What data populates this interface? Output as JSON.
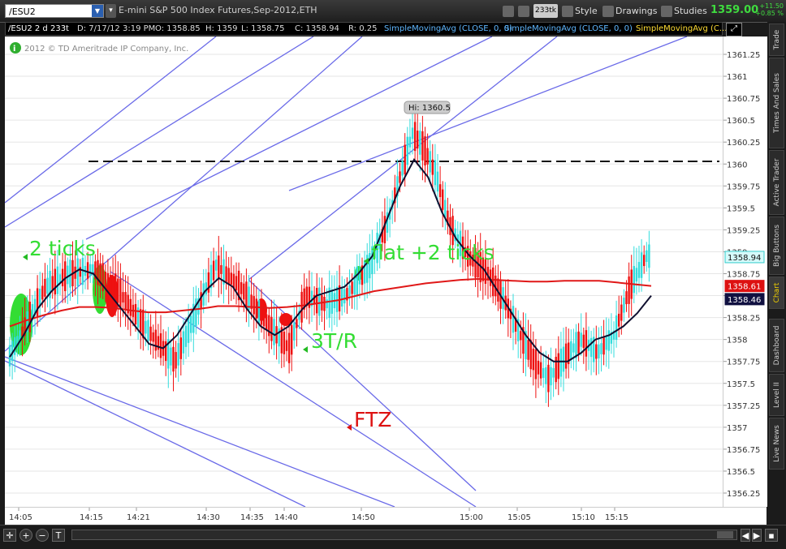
{
  "toolbar": {
    "symbol": "/ESU2",
    "description": "E-mini S&P 500 Index Futures,Sep-2012,ETH",
    "ticks_badge": "233tk",
    "style_label": "Style",
    "drawings_label": "Drawings",
    "studies_label": "Studies",
    "last_price": "1359.00",
    "change_abs": "+11.50",
    "change_pct": "+0.85 %"
  },
  "infobar": {
    "symbol_period": "/ESU2 2 d 233t",
    "date": "D: 7/17/12 3:19 PM",
    "open": "O: 1358.85",
    "high": "H: 1359",
    "low": "L: 1358.75",
    "close": "C: 1358.94",
    "range": "R: 0.25",
    "study1": "SimpleMovingAvg (CLOSE, 0, 0)",
    "study2": "SimpleMovingAvg (CLOSE, 0, 0)",
    "study3": "SimpleMovingAvg (C..."
  },
  "copyright": "2012 © TD Ameritrade IP Company, Inc.",
  "sidebar": {
    "tabs": [
      "Trade",
      "Times And Sales",
      "Active Trader",
      "Big Buttons",
      "Chart",
      "Dashboard",
      "Level II",
      "Live News"
    ]
  },
  "colors": {
    "up_bar": "#33dddd",
    "down_bar": "#ee1111",
    "trendline": "#6a6ae8",
    "sma_fast": "#101030",
    "sma_slow": "#e01818",
    "annot_green": "#33dd33",
    "annot_red": "#dd1111"
  },
  "chart_data": {
    "type": "candlestick",
    "y_ticks": [
      "1361.25",
      "1361",
      "1360.75",
      "1360.5",
      "1360.25",
      "1360",
      "1359.75",
      "1359.5",
      "1359.25",
      "1359",
      "1358.75",
      "1358.5",
      "1358.25",
      "1358",
      "1357.75",
      "1357.5",
      "1357.25",
      "1357",
      "1356.75",
      "1356.5",
      "1356.25"
    ],
    "ylim": [
      1356.1,
      1361.4
    ],
    "x_ticks": [
      "14:05",
      "14:15",
      "14:21",
      "14:30",
      "14:35",
      "14:40",
      "14:50",
      "15:00",
      "15:05",
      "15:10",
      "15:15"
    ],
    "price_tags": [
      {
        "label": "1358.94",
        "value": 1358.94,
        "color": "#33cccc"
      },
      {
        "label": "1358.61",
        "value": 1358.61,
        "color": "#dd1111"
      },
      {
        "label": "1358.46",
        "value": 1358.46,
        "color": "#101040"
      }
    ],
    "high_label": "Hi: 1360.5",
    "resistance_level": 1360.0,
    "annotations": [
      {
        "text": "2 ticks",
        "color": "green"
      },
      {
        "text": "flat +2 ticks",
        "color": "green"
      },
      {
        "text": "3T/R",
        "color": "green"
      },
      {
        "text": "FTZ",
        "color": "red"
      }
    ],
    "sma_fast": [
      1357.8,
      1358.05,
      1358.35,
      1358.55,
      1358.7,
      1358.8,
      1358.75,
      1358.55,
      1358.35,
      1358.15,
      1357.95,
      1357.9,
      1358.05,
      1358.3,
      1358.55,
      1358.7,
      1358.6,
      1358.35,
      1358.15,
      1358.05,
      1358.15,
      1358.35,
      1358.5,
      1358.55,
      1358.6,
      1358.75,
      1358.95,
      1359.35,
      1359.75,
      1360.05,
      1359.85,
      1359.45,
      1359.15,
      1358.95,
      1358.8,
      1358.55,
      1358.3,
      1358.05,
      1357.85,
      1357.75,
      1357.75,
      1357.85,
      1358.0,
      1358.05,
      1358.15,
      1358.3,
      1358.5
    ],
    "sma_slow": [
      1358.15,
      1358.22,
      1358.28,
      1358.33,
      1358.37,
      1358.37,
      1358.36,
      1358.33,
      1358.31,
      1358.31,
      1358.33,
      1358.35,
      1358.38,
      1358.38,
      1358.37,
      1358.36,
      1358.37,
      1358.39,
      1358.42,
      1358.45,
      1358.5,
      1358.55,
      1358.58,
      1358.61,
      1358.64,
      1358.66,
      1358.68,
      1358.69,
      1358.68,
      1358.67,
      1358.66,
      1358.66,
      1358.67,
      1358.67,
      1358.67,
      1358.65,
      1358.63,
      1358.61
    ]
  }
}
